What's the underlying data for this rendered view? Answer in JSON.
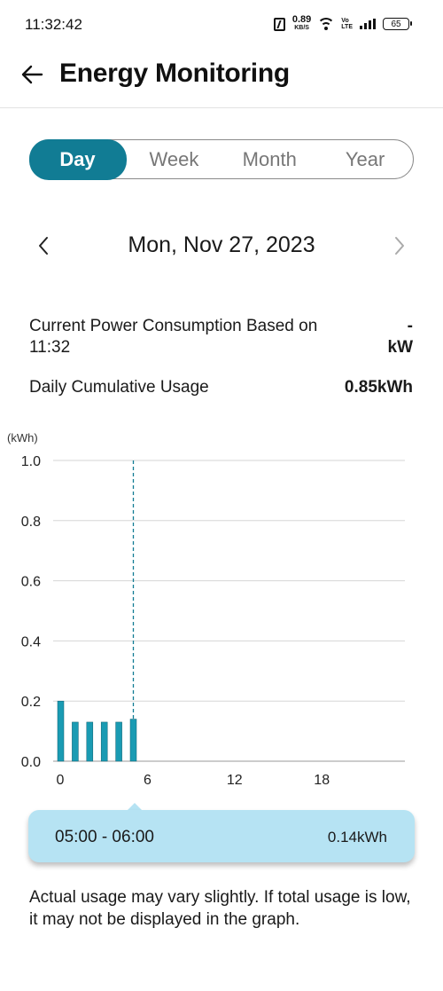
{
  "status_bar": {
    "time": "11:32:42",
    "net_speed": "0.89",
    "net_speed_unit": "KB/S",
    "volte_top": "Vo",
    "volte_bottom": "LTE",
    "battery": "65"
  },
  "header": {
    "title": "Energy Monitoring",
    "back_icon": "arrow-left-icon"
  },
  "period_tabs": [
    {
      "label": "Day",
      "selected": true
    },
    {
      "label": "Week",
      "selected": false
    },
    {
      "label": "Month",
      "selected": false
    },
    {
      "label": "Year",
      "selected": false
    }
  ],
  "date_nav": {
    "date": "Mon, Nov 27, 2023",
    "prev_icon": "chevron-left-icon",
    "next_icon": "chevron-right-icon"
  },
  "summary": {
    "current_label": "Current Power Consumption Based on 11:32",
    "current_value_line1": "-",
    "current_value_line2": "kW",
    "daily_label": "Daily Cumulative Usage",
    "daily_value": "0.85kWh"
  },
  "colors": {
    "accent": "#117c94",
    "bar": "#1a9bb3",
    "tooltip_bg": "#b6e3f3"
  },
  "chart_data": {
    "type": "bar",
    "ylabel": "(kWh)",
    "ylim": [
      0,
      1.0
    ],
    "yticks": [
      "0.0",
      "0.2",
      "0.4",
      "0.6",
      "0.8",
      "1.0"
    ],
    "xticks": [
      "0",
      "6",
      "12",
      "18"
    ],
    "x_range": [
      0,
      24
    ],
    "x": [
      0,
      1,
      2,
      3,
      4,
      5
    ],
    "values": [
      0.2,
      0.13,
      0.13,
      0.13,
      0.13,
      0.14
    ],
    "selected_x": 5,
    "grid": true
  },
  "tooltip": {
    "range": "05:00 - 06:00",
    "value": "0.14kWh"
  },
  "disclaimer": "Actual usage may vary slightly. If total usage is low, it may not be displayed in the graph."
}
